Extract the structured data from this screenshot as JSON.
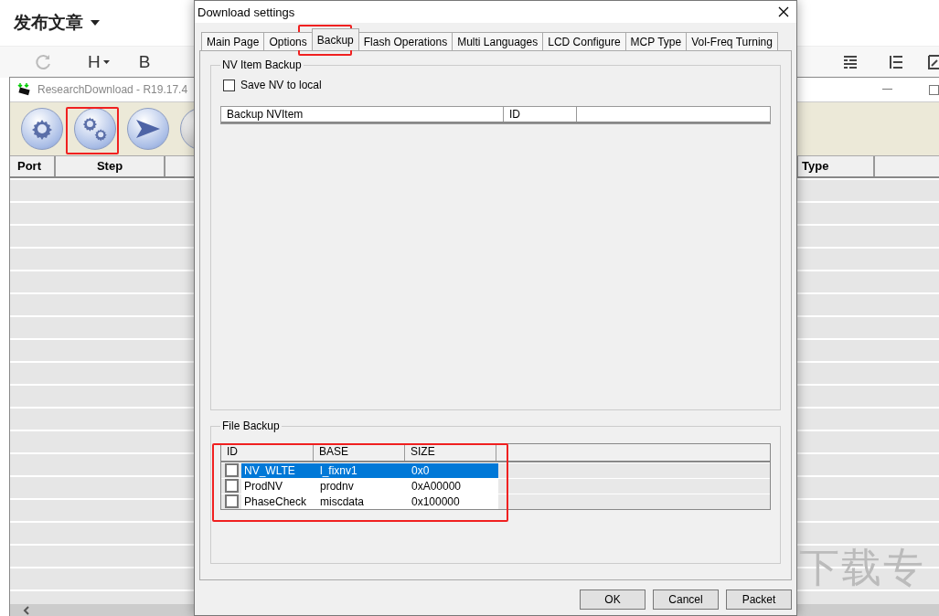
{
  "editor": {
    "title": "发布文章",
    "toolbar": [
      "H",
      "B"
    ],
    "background_text": "下载专"
  },
  "research_window": {
    "title": "ResearchDownload - R19.17.4",
    "columns_left": [
      "Port",
      "Step"
    ],
    "columns_right": [
      "Type"
    ]
  },
  "dialog": {
    "title": "Download settings",
    "tabs": [
      {
        "label": "Main Page",
        "selected": false
      },
      {
        "label": "Options",
        "selected": false
      },
      {
        "label": "Backup",
        "selected": true
      },
      {
        "label": "Flash Operations",
        "selected": false
      },
      {
        "label": "Multi Languages",
        "selected": false
      },
      {
        "label": "LCD Configure",
        "selected": false
      },
      {
        "label": "MCP Type",
        "selected": false
      },
      {
        "label": "Vol-Freq Turning",
        "selected": false
      }
    ],
    "nv_backup": {
      "title": "NV Item Backup",
      "save_nv": {
        "label": "Save NV to local",
        "checked": false
      },
      "columns": [
        "Backup NVItem",
        "ID"
      ]
    },
    "file_backup": {
      "title": "File Backup",
      "columns": [
        "ID",
        "BASE",
        "SIZE"
      ],
      "rows": [
        {
          "id": "NV_WLTE",
          "base": "l_fixnv1",
          "size": "0x0",
          "checked": false,
          "selected": true
        },
        {
          "id": "ProdNV",
          "base": "prodnv",
          "size": "0xA00000",
          "checked": false,
          "selected": false
        },
        {
          "id": "PhaseCheck",
          "base": "miscdata",
          "size": "0x100000",
          "checked": false,
          "selected": false
        }
      ]
    },
    "buttons": [
      "OK",
      "Cancel",
      "Packet"
    ]
  }
}
